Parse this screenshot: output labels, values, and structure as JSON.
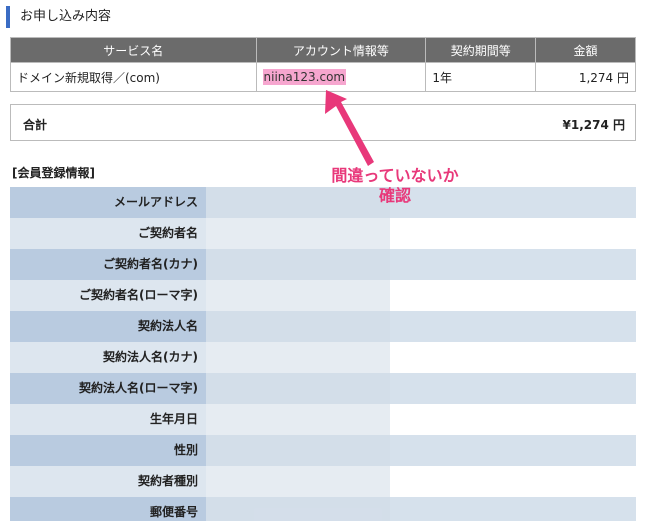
{
  "order": {
    "section_title": "お申し込み内容",
    "headers": [
      "サービス名",
      "アカウント情報等",
      "契約期間等",
      "金額"
    ],
    "row": {
      "service": "ドメイン新規取得／(com)",
      "account": "niina123.com",
      "period": "1年",
      "amount": "1,274 円"
    },
    "total_label": "合計",
    "total_value": "¥1,274 円"
  },
  "member": {
    "title": "[会員登録情報]",
    "fields": [
      {
        "label": "メールアドレス"
      },
      {
        "label": "ご契約者名"
      },
      {
        "label": "ご契約者名(カナ)"
      },
      {
        "label": "ご契約者名(ローマ字)"
      },
      {
        "label": "契約法人名"
      },
      {
        "label": "契約法人名(カナ)"
      },
      {
        "label": "契約法人名(ローマ字)"
      },
      {
        "label": "生年月日"
      },
      {
        "label": "性別"
      },
      {
        "label": "契約者種別"
      },
      {
        "label": "郵便番号"
      }
    ]
  },
  "annotation": {
    "line1": "間違っていないか",
    "line2": "確認",
    "color": "#e8387a"
  },
  "colors": {
    "accent_bar": "#3a6cc4",
    "header_bg": "#6b6b6b",
    "highlight": "#f6a6cf"
  }
}
